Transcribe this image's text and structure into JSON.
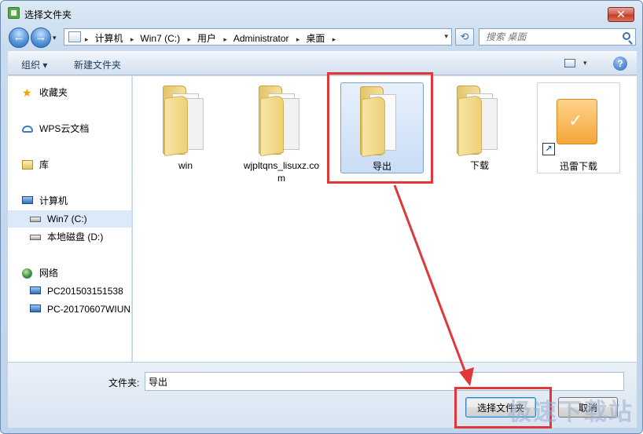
{
  "window": {
    "title": "选择文件夹",
    "close_glyph": "✕"
  },
  "nav_buttons": {
    "back_glyph": "←",
    "forward_glyph": "→",
    "history_glyph": "▾"
  },
  "address": {
    "crumbs": [
      "计算机",
      "Win7 (C:)",
      "用户",
      "Administrator",
      "桌面"
    ],
    "separator": "▸",
    "dropdown_glyph": "▾",
    "refresh_glyph": "⟲"
  },
  "search": {
    "placeholder": "搜索 桌面"
  },
  "toolbar": {
    "organize": "组织 ▾",
    "new_folder": "新建文件夹",
    "view_drop": "▾",
    "help": "?"
  },
  "sidebar": {
    "items": [
      {
        "label": "收藏夹",
        "icon": "star-icon"
      },
      {
        "label": "WPS云文档",
        "icon": "cloud-icon"
      },
      {
        "label": "库",
        "icon": "library-icon"
      },
      {
        "label": "计算机",
        "icon": "computer-icon"
      },
      {
        "label": "Win7 (C:)",
        "icon": "drive-icon",
        "selected": true
      },
      {
        "label": "本地磁盘 (D:)",
        "icon": "drive-icon"
      },
      {
        "label": "网络",
        "icon": "network-icon"
      },
      {
        "label": "PC201503151538",
        "icon": "computer-icon"
      },
      {
        "label": "PC-20170607WIUN",
        "icon": "computer-icon"
      }
    ]
  },
  "files": [
    {
      "name": "win",
      "type": "folder"
    },
    {
      "name": "wjpltqns_lisuxz.com",
      "type": "folder"
    },
    {
      "name": "导出",
      "type": "folder",
      "selected": true
    },
    {
      "name": "下载",
      "type": "folder"
    },
    {
      "name": "迅雷下载",
      "type": "shortcut"
    }
  ],
  "footer": {
    "folder_label": "文件夹:",
    "folder_value": "导出",
    "select_button": "选择文件夹",
    "cancel_button": "取消"
  },
  "annotation": {
    "color": "#e0383a"
  },
  "watermark": "极速下载站"
}
